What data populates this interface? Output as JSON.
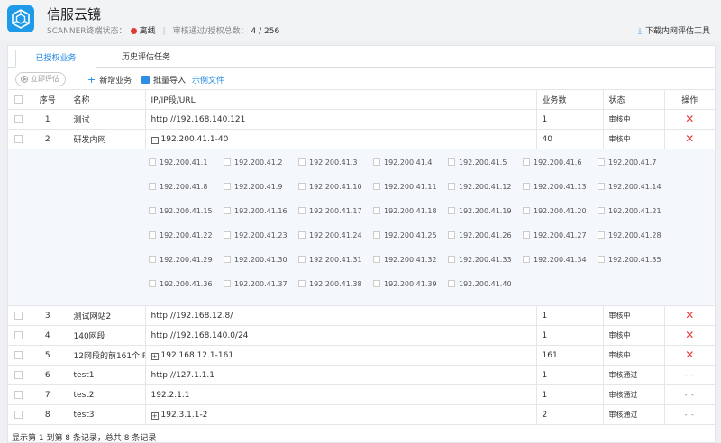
{
  "app": {
    "title": "信服云镜",
    "status_label": "SCANNER终端状态：",
    "status_value": "离线",
    "audit_label": "审核通过/授权总数：",
    "audit_value": "4 / 256",
    "download_label": "下载内网评估工具",
    "status_color": "#e53935",
    "accent_color": "#1e88e5"
  },
  "tabs": [
    {
      "label": "已授权业务",
      "active": true
    },
    {
      "label": "历史评估任务",
      "active": false
    }
  ],
  "toolbar": {
    "eval_label": "立即评估",
    "add_label": "新增业务",
    "import_label": "批量导入",
    "sample_label": "示例文件"
  },
  "table": {
    "headers": {
      "num": "序号",
      "name": "名称",
      "url": "IP/IP段/URL",
      "count": "业务数",
      "status": "状态",
      "op": "操作"
    },
    "rows": [
      {
        "num": "1",
        "name": "测试",
        "url": "http://192.168.140.121",
        "count": "1",
        "status": "审核中",
        "op": "delete",
        "range": false
      },
      {
        "num": "2",
        "name": "研发内网",
        "url": "192.200.41.1-40",
        "count": "40",
        "status": "审核中",
        "op": "delete",
        "range": true,
        "expanded": true
      },
      {
        "num": "3",
        "name": "测试网站2",
        "url": "http://192.168.12.8/",
        "count": "1",
        "status": "审核中",
        "op": "delete",
        "range": false
      },
      {
        "num": "4",
        "name": "140网段",
        "url": "http://192.168.140.0/24",
        "count": "1",
        "status": "审核中",
        "op": "delete",
        "range": false
      },
      {
        "num": "5",
        "name": "12网段的前161个IP",
        "url": "192.168.12.1-161",
        "count": "161",
        "status": "审核中",
        "op": "delete",
        "range": true
      },
      {
        "num": "6",
        "name": "test1",
        "url": "http://127.1.1.1",
        "count": "1",
        "status": "审核通过",
        "op": "- -",
        "range": false
      },
      {
        "num": "7",
        "name": "test2",
        "url": "192.2.1.1",
        "count": "1",
        "status": "审核通过",
        "op": "- -",
        "range": false
      },
      {
        "num": "8",
        "name": "test3",
        "url": "192.3.1.1-2",
        "count": "2",
        "status": "审核通过",
        "op": "- -",
        "range": true
      }
    ],
    "expanded_ips": [
      "192.200.41.1",
      "192.200.41.2",
      "192.200.41.3",
      "192.200.41.4",
      "192.200.41.5",
      "192.200.41.6",
      "192.200.41.7",
      "192.200.41.8",
      "192.200.41.9",
      "192.200.41.10",
      "192.200.41.11",
      "192.200.41.12",
      "192.200.41.13",
      "192.200.41.14",
      "192.200.41.15",
      "192.200.41.16",
      "192.200.41.17",
      "192.200.41.18",
      "192.200.41.19",
      "192.200.41.20",
      "192.200.41.21",
      "192.200.41.22",
      "192.200.41.23",
      "192.200.41.24",
      "192.200.41.25",
      "192.200.41.26",
      "192.200.41.27",
      "192.200.41.28",
      "192.200.41.29",
      "192.200.41.30",
      "192.200.41.31",
      "192.200.41.32",
      "192.200.41.33",
      "192.200.41.34",
      "192.200.41.35",
      "192.200.41.36",
      "192.200.41.37",
      "192.200.41.38",
      "192.200.41.39",
      "192.200.41.40"
    ]
  },
  "footer": {
    "summary": "显示第 1 到第 8 条记录，总共 8 条记录"
  }
}
